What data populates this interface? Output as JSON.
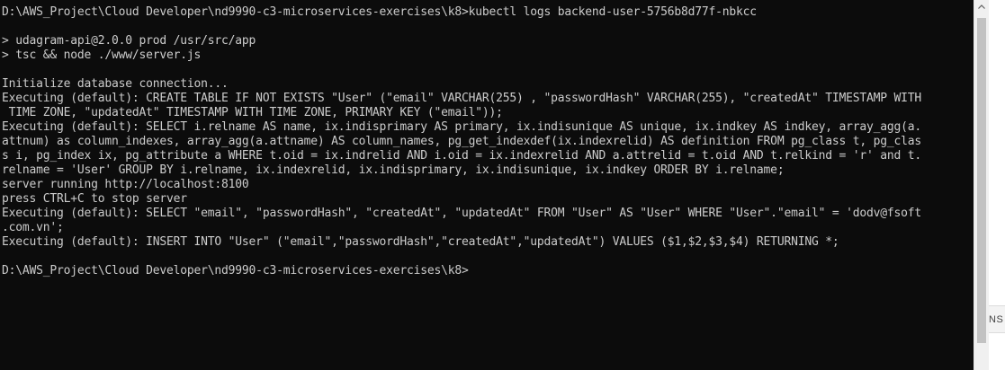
{
  "console": {
    "lines": [
      "D:\\AWS_Project\\Cloud Developer\\nd9990-c3-microservices-exercises\\k8>kubectl logs backend-user-5756b8d77f-nbkcc",
      "",
      "> udagram-api@2.0.0 prod /usr/src/app",
      "> tsc && node ./www/server.js",
      "",
      "Initialize database connection...",
      "Executing (default): CREATE TABLE IF NOT EXISTS \"User\" (\"email\" VARCHAR(255) , \"passwordHash\" VARCHAR(255), \"createdAt\" TIMESTAMP WITH",
      " TIME ZONE, \"updatedAt\" TIMESTAMP WITH TIME ZONE, PRIMARY KEY (\"email\"));",
      "Executing (default): SELECT i.relname AS name, ix.indisprimary AS primary, ix.indisunique AS unique, ix.indkey AS indkey, array_agg(a.",
      "attnum) as column_indexes, array_agg(a.attname) AS column_names, pg_get_indexdef(ix.indexrelid) AS definition FROM pg_class t, pg_clas",
      "s i, pg_index ix, pg_attribute a WHERE t.oid = ix.indrelid AND i.oid = ix.indexrelid AND a.attrelid = t.oid AND t.relkind = 'r' and t.",
      "relname = 'User' GROUP BY i.relname, ix.indexrelid, ix.indisprimary, ix.indisunique, ix.indkey ORDER BY i.relname;",
      "server running http://localhost:8100",
      "press CTRL+C to stop server",
      "Executing (default): SELECT \"email\", \"passwordHash\", \"createdAt\", \"updatedAt\" FROM \"User\" AS \"User\" WHERE \"User\".\"email\" = 'dodv@fsoft",
      ".com.vn';",
      "Executing (default): INSERT INTO \"User\" (\"email\",\"passwordHash\",\"createdAt\",\"updatedAt\") VALUES ($1,$2,$3,$4) RETURNING *;",
      "",
      "D:\\AWS_Project\\Cloud Developer\\nd9990-c3-microservices-exercises\\k8>"
    ]
  },
  "backdrop": {
    "partial_text": "NS"
  },
  "icons": {
    "scroll_up": "chevron-up-icon"
  },
  "colors": {
    "background": "#0c0c0c",
    "text": "#cccccc",
    "scrollbar_track": "#f0f0f0",
    "scrollbar_thumb": "#c2c2c2"
  }
}
